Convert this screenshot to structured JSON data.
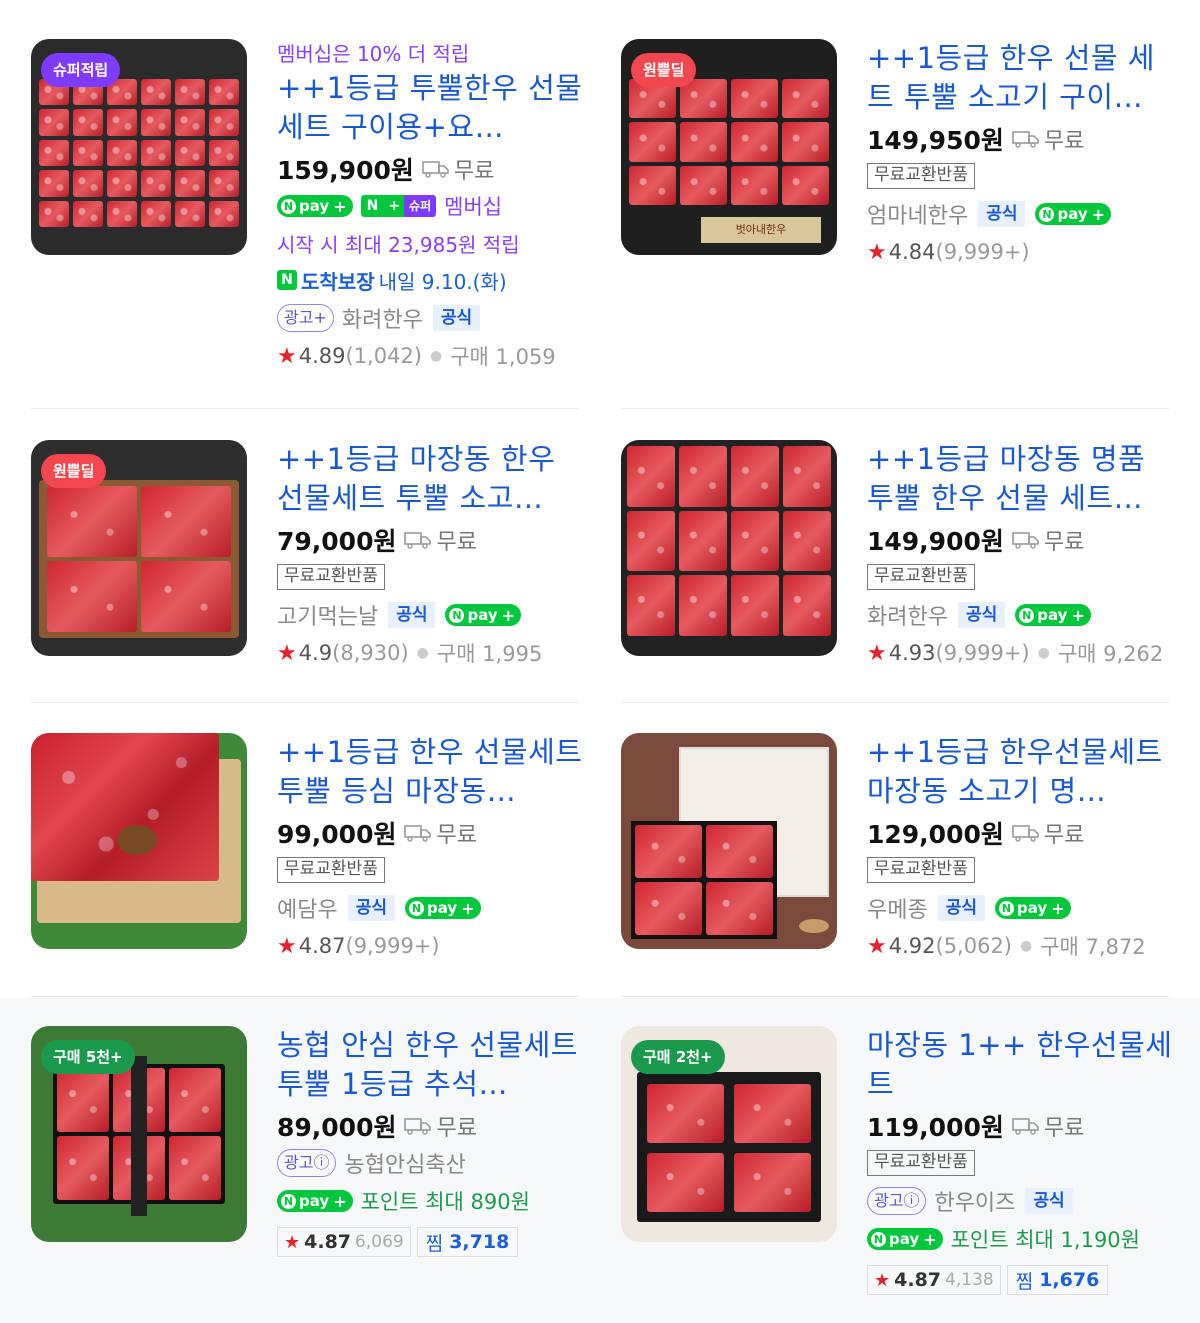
{
  "products": [
    {
      "badge": "슈퍼적립",
      "badge_color": "#7d3bff",
      "promo": "멤버십은 10% 더 적립",
      "title": "++1등급 투뿔한우 선물 세트 구이용+요…",
      "price": "159,900원",
      "shipping": "무료",
      "membership_label": "멤버십",
      "accumulate": "시작 시 최대 23,985원 적립",
      "arrival_label": "도착보장",
      "arrival_date": "내일 9.10.(화)",
      "ad_label": "광고+",
      "seller": "화려한우",
      "official": "공식",
      "rating": "4.89",
      "review_count": "(1,042)",
      "purchase": "구매 1,059"
    },
    {
      "badge": "원쁠딜",
      "badge_color": "#f2474f",
      "title": "++1등급 한우 선물 세트 투뿔 소고기 구이…",
      "price": "149,950원",
      "shipping": "무료",
      "tag": "무료교환반품",
      "seller": "엄마네한우",
      "official": "공식",
      "rating": "4.84",
      "review_count": "(9,999+)"
    },
    {
      "badge": "원쁠딜",
      "badge_color": "#f2474f",
      "title": "++1등급 마장동 한우 선물세트 투뿔 소고…",
      "price": "79,000원",
      "shipping": "무료",
      "tag": "무료교환반품",
      "seller": "고기먹는날",
      "official": "공식",
      "rating": "4.9",
      "review_count": "(8,930)",
      "purchase": "구매 1,995"
    },
    {
      "title": "++1등급 마장동 명품 투뿔 한우 선물 세트…",
      "price": "149,900원",
      "shipping": "무료",
      "tag": "무료교환반품",
      "seller": "화려한우",
      "official": "공식",
      "rating": "4.93",
      "review_count": "(9,999+)",
      "purchase": "구매 9,262"
    },
    {
      "title": "++1등급 한우 선물세트 투뿔 등심 마장동…",
      "price": "99,000원",
      "shipping": "무료",
      "tag": "무료교환반품",
      "seller": "예담우",
      "official": "공식",
      "rating": "4.87",
      "review_count": "(9,999+)"
    },
    {
      "title": "++1등급 한우선물세트 마장동 소고기 명…",
      "price": "129,000원",
      "shipping": "무료",
      "tag": "무료교환반품",
      "seller": "우메종",
      "official": "공식",
      "rating": "4.92",
      "review_count": "(5,062)",
      "purchase": "구매 7,872"
    },
    {
      "badge": "구매 5천+",
      "badge_color": "#1b9a4e",
      "title": "농협 안심 한우 선물세트 투뿔 1등급 추석…",
      "price": "89,000원",
      "shipping": "무료",
      "ad_label": "광고ⓘ",
      "seller": "농협안심축산",
      "point": "포인트 최대 890원",
      "rating": "4.87",
      "review_count": "6,069",
      "zzim_label": "찜",
      "zzim_count": "3,718"
    },
    {
      "badge": "구매 2천+",
      "badge_color": "#1b9a4e",
      "title": "마장동 1++ 한우선물세트",
      "price": "119,000원",
      "shipping": "무료",
      "tag": "무료교환반품",
      "ad_label": "광고ⓘ",
      "seller": "한우이즈",
      "official": "공식",
      "point": "포인트 최대 1,190원",
      "rating": "4.87",
      "review_count": "4,138",
      "zzim_label": "찜",
      "zzim_count": "1,676"
    }
  ],
  "npay_label": "pay",
  "npay_n": "N",
  "super_label": "슈퍼",
  "gift_label": "벗아내한우"
}
